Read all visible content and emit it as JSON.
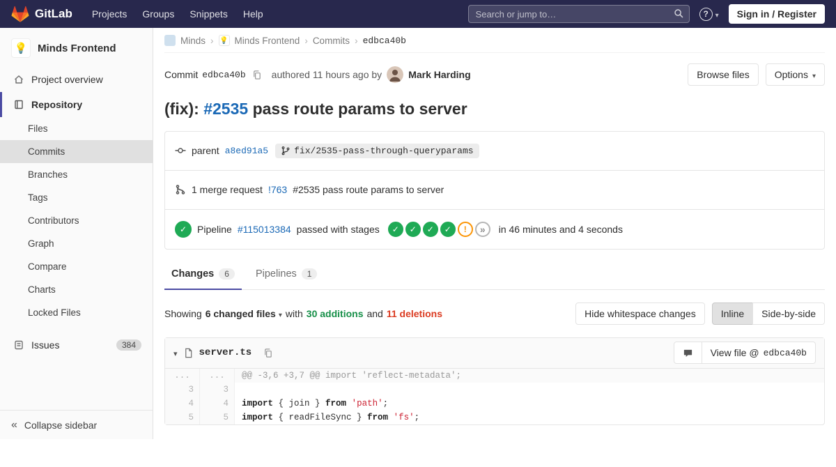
{
  "navbar": {
    "logo": "GitLab",
    "menu": [
      "Projects",
      "Groups",
      "Snippets",
      "Help"
    ],
    "search_placeholder": "Search or jump to…",
    "signin": "Sign in / Register"
  },
  "sidebar": {
    "avatar": "💡",
    "project": "Minds Frontend",
    "overview": "Project overview",
    "repository": "Repository",
    "repo_items": [
      "Files",
      "Commits",
      "Branches",
      "Tags",
      "Contributors",
      "Graph",
      "Compare",
      "Charts",
      "Locked Files"
    ],
    "issues": "Issues",
    "issues_count": "384",
    "collapse": "Collapse sidebar"
  },
  "breadcrumb": {
    "group": "Minds",
    "project_avatar": "💡",
    "project": "Minds Frontend",
    "section": "Commits",
    "current": "edbca40b"
  },
  "commit": {
    "label": "Commit",
    "sha": "edbca40b",
    "authored": "authored 11 hours ago by",
    "author": "Mark Harding",
    "browse_files": "Browse files",
    "options": "Options",
    "title": {
      "prefix": "(fix): ",
      "issue": "#2535",
      "rest": " pass route params to server"
    },
    "parent": {
      "label": "parent",
      "sha": "a8ed91a5",
      "branch": "fix/2535-pass-through-queryparams"
    },
    "merge_request": {
      "count_text": "1 merge request",
      "id": "!763",
      "title": "#2535 pass route params to server"
    },
    "pipeline": {
      "label": "Pipeline",
      "id": "#115013384",
      "status": "passed with stages",
      "stages": [
        "success",
        "success",
        "success",
        "success",
        "warning",
        "skipped"
      ],
      "duration": "in 46 minutes and 4 seconds"
    }
  },
  "tabs": {
    "changes": "Changes",
    "changes_count": "6",
    "pipelines": "Pipelines",
    "pipelines_count": "1"
  },
  "stats": {
    "showing": "Showing",
    "files": "6 changed files",
    "with": "with",
    "additions": "30 additions",
    "and": "and",
    "deletions": "11 deletions",
    "hide_whitespace": "Hide whitespace changes",
    "inline": "Inline",
    "side_by_side": "Side-by-side"
  },
  "diff": {
    "file_name": "server.ts",
    "view_file_label": "View file @",
    "view_file_sha": "edbca40b",
    "lines": [
      {
        "type": "hunk",
        "old": "...",
        "new": "...",
        "content": "@@ -3,6 +3,7 @@ import 'reflect-metadata';"
      },
      {
        "type": "context",
        "old": "3",
        "new": "3",
        "content": ""
      },
      {
        "type": "context",
        "old": "4",
        "new": "4",
        "segments": [
          "import",
          " { join } ",
          "from",
          " ",
          "'path'",
          ";"
        ]
      },
      {
        "type": "context",
        "old": "5",
        "new": "5",
        "segments": [
          "import",
          " { readFileSync } ",
          "from",
          " ",
          "'fs'",
          ";"
        ]
      }
    ]
  }
}
